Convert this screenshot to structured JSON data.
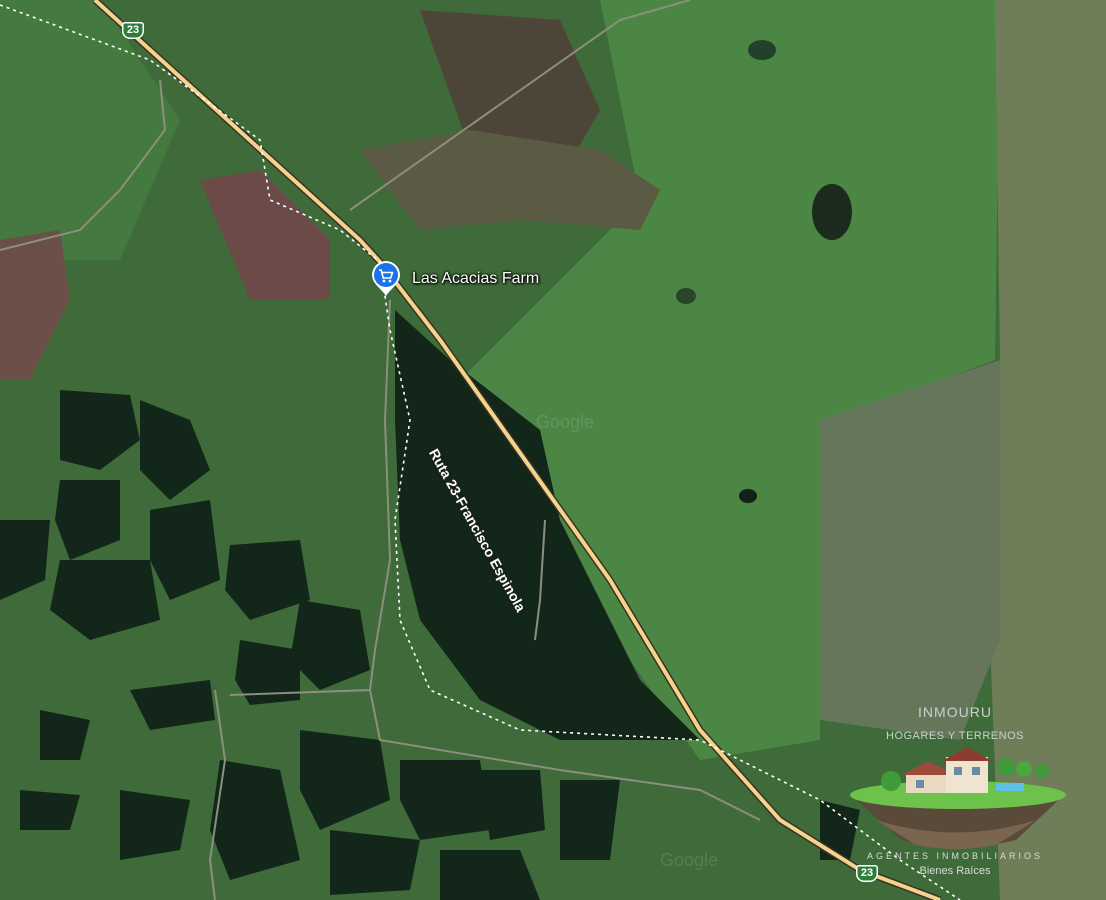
{
  "map": {
    "view": "satellite",
    "road_color": "#f3d48e",
    "trail_color": "#ffffff",
    "grass_color": "#3f6b3a",
    "forest_color": "#16301f"
  },
  "route_shields": [
    {
      "number": "23"
    },
    {
      "number": "23"
    }
  ],
  "place": {
    "name": "Las Acacias Farm",
    "icon": "shopping-cart-icon",
    "pin_color": "#1a73e8"
  },
  "road": {
    "label": "Ruta 23-Francisco Espinola"
  },
  "watermarks": [
    "Google",
    "Google"
  ],
  "logo": {
    "title": "INMOURU",
    "subtitle": "HOGARES Y TERRENOS",
    "tagline": "AGENTES INMOBILIARIOS",
    "tagline2": "Bienes Raíces"
  }
}
